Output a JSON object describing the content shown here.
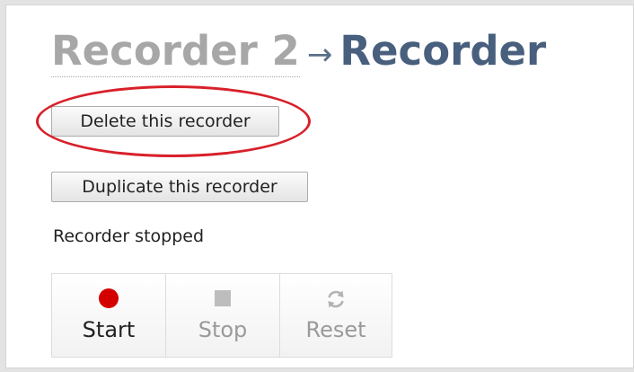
{
  "header": {
    "parent": "Recorder 2",
    "arrow": "→",
    "current": "Recorder"
  },
  "actions": {
    "delete_label": "Delete this recorder",
    "duplicate_label": "Duplicate this recorder"
  },
  "status": {
    "text": "Recorder stopped"
  },
  "controls": [
    {
      "label": "Start",
      "icon": "record-icon",
      "enabled": true
    },
    {
      "label": "Stop",
      "icon": "stop-icon",
      "enabled": false
    },
    {
      "label": "Reset",
      "icon": "refresh-icon",
      "enabled": false
    }
  ],
  "colors": {
    "title_parent": "#a7a7a7",
    "title_current": "#485f7d",
    "highlight": "#d8202a",
    "record": "#d40000"
  }
}
